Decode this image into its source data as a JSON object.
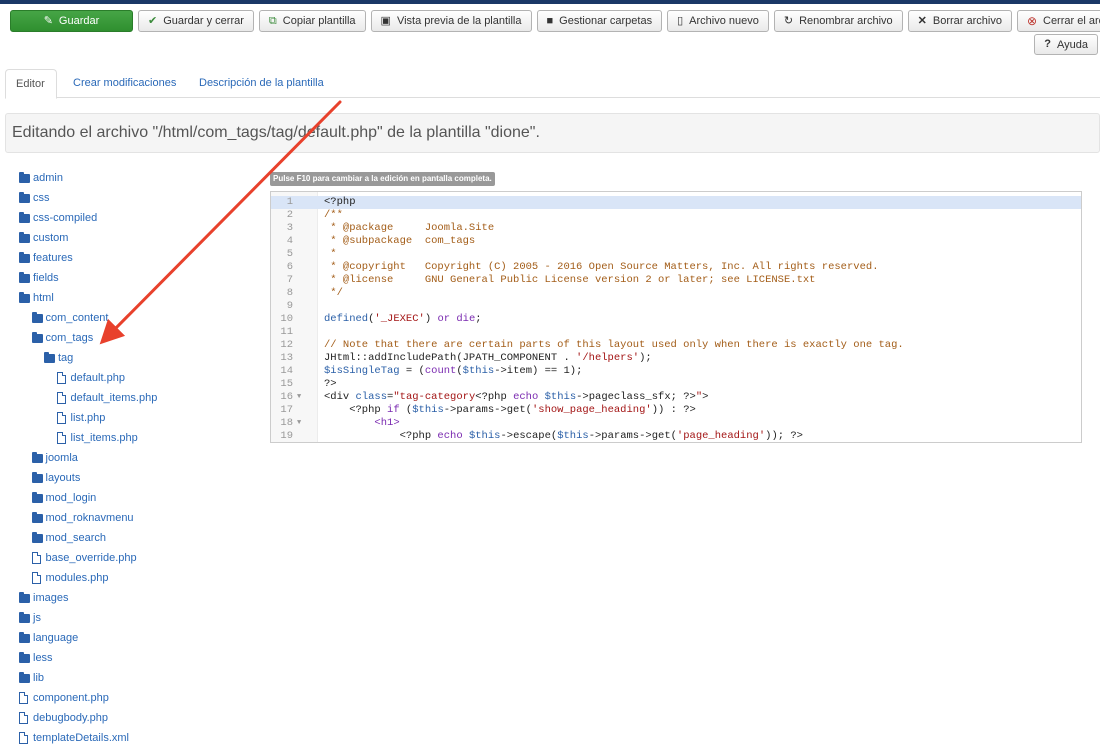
{
  "toolbar": {
    "save": "Guardar",
    "save_close": "Guardar y cerrar",
    "copy": "Copiar plantilla",
    "preview": "Vista previa de la plantilla",
    "folders": "Gestionar carpetas",
    "new_file": "Archivo nuevo",
    "rename": "Renombrar archivo",
    "delete": "Borrar archivo",
    "close": "Cerrar el archivo",
    "help": "Ayuda"
  },
  "tabs": [
    "Editor",
    "Crear modificaciones",
    "Descripción de la plantilla"
  ],
  "editing_title": "Editando el archivo \"/html/com_tags/tag/default.php\" de la plantilla \"dione\".",
  "fullscreen_hint": "Pulse F10 para cambiar a la edición en pantalla completa.",
  "tree": [
    {
      "label": "admin",
      "type": "folder",
      "depth": 0
    },
    {
      "label": "css",
      "type": "folder",
      "depth": 0
    },
    {
      "label": "css-compiled",
      "type": "folder",
      "depth": 0
    },
    {
      "label": "custom",
      "type": "folder",
      "depth": 0
    },
    {
      "label": "features",
      "type": "folder",
      "depth": 0
    },
    {
      "label": "fields",
      "type": "folder",
      "depth": 0
    },
    {
      "label": "html",
      "type": "folder",
      "depth": 0
    },
    {
      "label": "com_content",
      "type": "folder",
      "depth": 1
    },
    {
      "label": "com_tags",
      "type": "folder",
      "depth": 1
    },
    {
      "label": "tag",
      "type": "folder",
      "depth": 2
    },
    {
      "label": "default.php",
      "type": "file",
      "depth": 3
    },
    {
      "label": "default_items.php",
      "type": "file",
      "depth": 3
    },
    {
      "label": "list.php",
      "type": "file",
      "depth": 3
    },
    {
      "label": "list_items.php",
      "type": "file",
      "depth": 3
    },
    {
      "label": "joomla",
      "type": "folder",
      "depth": 1
    },
    {
      "label": "layouts",
      "type": "folder",
      "depth": 1
    },
    {
      "label": "mod_login",
      "type": "folder",
      "depth": 1
    },
    {
      "label": "mod_roknavmenu",
      "type": "folder",
      "depth": 1
    },
    {
      "label": "mod_search",
      "type": "folder",
      "depth": 1
    },
    {
      "label": "base_override.php",
      "type": "file",
      "depth": 1
    },
    {
      "label": "modules.php",
      "type": "file",
      "depth": 1
    },
    {
      "label": "images",
      "type": "folder",
      "depth": 0
    },
    {
      "label": "js",
      "type": "folder",
      "depth": 0
    },
    {
      "label": "language",
      "type": "folder",
      "depth": 0
    },
    {
      "label": "less",
      "type": "folder",
      "depth": 0
    },
    {
      "label": "lib",
      "type": "folder",
      "depth": 0
    },
    {
      "label": "component.php",
      "type": "file",
      "depth": 0
    },
    {
      "label": "debugbody.php",
      "type": "file",
      "depth": 0
    },
    {
      "label": "templateDetails.xml",
      "type": "file",
      "depth": 0
    }
  ],
  "code_lines": [
    {
      "n": "1",
      "fold": false,
      "active": true,
      "tokens": [
        [
          "tx",
          "<?php"
        ]
      ]
    },
    {
      "n": "2",
      "fold": false,
      "tokens": [
        [
          "cm",
          "/**"
        ]
      ]
    },
    {
      "n": "3",
      "fold": false,
      "tokens": [
        [
          "cm",
          " * @package     Joomla.Site"
        ]
      ]
    },
    {
      "n": "4",
      "fold": false,
      "tokens": [
        [
          "cm",
          " * @subpackage  com_tags"
        ]
      ]
    },
    {
      "n": "5",
      "fold": false,
      "tokens": [
        [
          "cm",
          " *"
        ]
      ]
    },
    {
      "n": "6",
      "fold": false,
      "tokens": [
        [
          "cm",
          " * @copyright   Copyright (C) 2005 - 2016 Open Source Matters, Inc. All rights reserved."
        ]
      ]
    },
    {
      "n": "7",
      "fold": false,
      "tokens": [
        [
          "cm",
          " * @license     GNU General Public License version 2 or later; see LICENSE.txt"
        ]
      ]
    },
    {
      "n": "8",
      "fold": false,
      "tokens": [
        [
          "cm",
          " */"
        ]
      ]
    },
    {
      "n": "9",
      "fold": false,
      "tokens": []
    },
    {
      "n": "10",
      "fold": false,
      "tokens": [
        [
          "var",
          "defined"
        ],
        [
          "tx",
          "("
        ],
        [
          "str",
          "'_JEXEC'"
        ],
        [
          "tx",
          ") "
        ],
        [
          "kw",
          "or"
        ],
        [
          "tx",
          " "
        ],
        [
          "kw",
          "die"
        ],
        [
          "tx",
          ";"
        ]
      ]
    },
    {
      "n": "11",
      "fold": false,
      "tokens": []
    },
    {
      "n": "12",
      "fold": false,
      "tokens": [
        [
          "cm",
          "// Note that there are certain parts of this layout used only when there is exactly one tag."
        ]
      ]
    },
    {
      "n": "13",
      "fold": false,
      "tokens": [
        [
          "tx",
          "JHtml::addIncludePath(JPATH_COMPONENT . "
        ],
        [
          "str",
          "'/helpers'"
        ],
        [
          "tx",
          ");"
        ]
      ]
    },
    {
      "n": "14",
      "fold": false,
      "tokens": [
        [
          "var",
          "$isSingleTag"
        ],
        [
          "tx",
          " = ("
        ],
        [
          "kw",
          "count"
        ],
        [
          "tx",
          "("
        ],
        [
          "var",
          "$this"
        ],
        [
          "tx",
          "->item) == 1);"
        ]
      ]
    },
    {
      "n": "15",
      "fold": false,
      "tokens": [
        [
          "tx",
          "?>"
        ]
      ]
    },
    {
      "n": "16",
      "fold": true,
      "tokens": [
        [
          "tx",
          "<div "
        ],
        [
          "var",
          "class"
        ],
        [
          "tx",
          "="
        ],
        [
          "str",
          "\"tag-category"
        ],
        [
          "tx",
          "<?php "
        ],
        [
          "kw",
          "echo"
        ],
        [
          "tx",
          " "
        ],
        [
          "var",
          "$this"
        ],
        [
          "tx",
          "->pageclass_sfx; ?>"
        ],
        [
          "str",
          "\""
        ],
        [
          "tx",
          ">"
        ]
      ]
    },
    {
      "n": "17",
      "fold": false,
      "tokens": [
        [
          "tx",
          "    <?php "
        ],
        [
          "kw",
          "if"
        ],
        [
          "tx",
          " ("
        ],
        [
          "var",
          "$this"
        ],
        [
          "tx",
          "->params->get("
        ],
        [
          "str",
          "'show_page_heading'"
        ],
        [
          "tx",
          ")) : ?>"
        ]
      ]
    },
    {
      "n": "18",
      "fold": true,
      "tokens": [
        [
          "tx",
          "        "
        ],
        [
          "kw",
          "<h1>"
        ]
      ]
    },
    {
      "n": "19",
      "fold": false,
      "tokens": [
        [
          "tx",
          "            <?php "
        ],
        [
          "kw",
          "echo"
        ],
        [
          "tx",
          " "
        ],
        [
          "var",
          "$this"
        ],
        [
          "tx",
          "->escape("
        ],
        [
          "var",
          "$this"
        ],
        [
          "tx",
          "->params->get("
        ],
        [
          "str",
          "'page_heading'"
        ],
        [
          "tx",
          ")); ?>"
        ]
      ]
    }
  ]
}
